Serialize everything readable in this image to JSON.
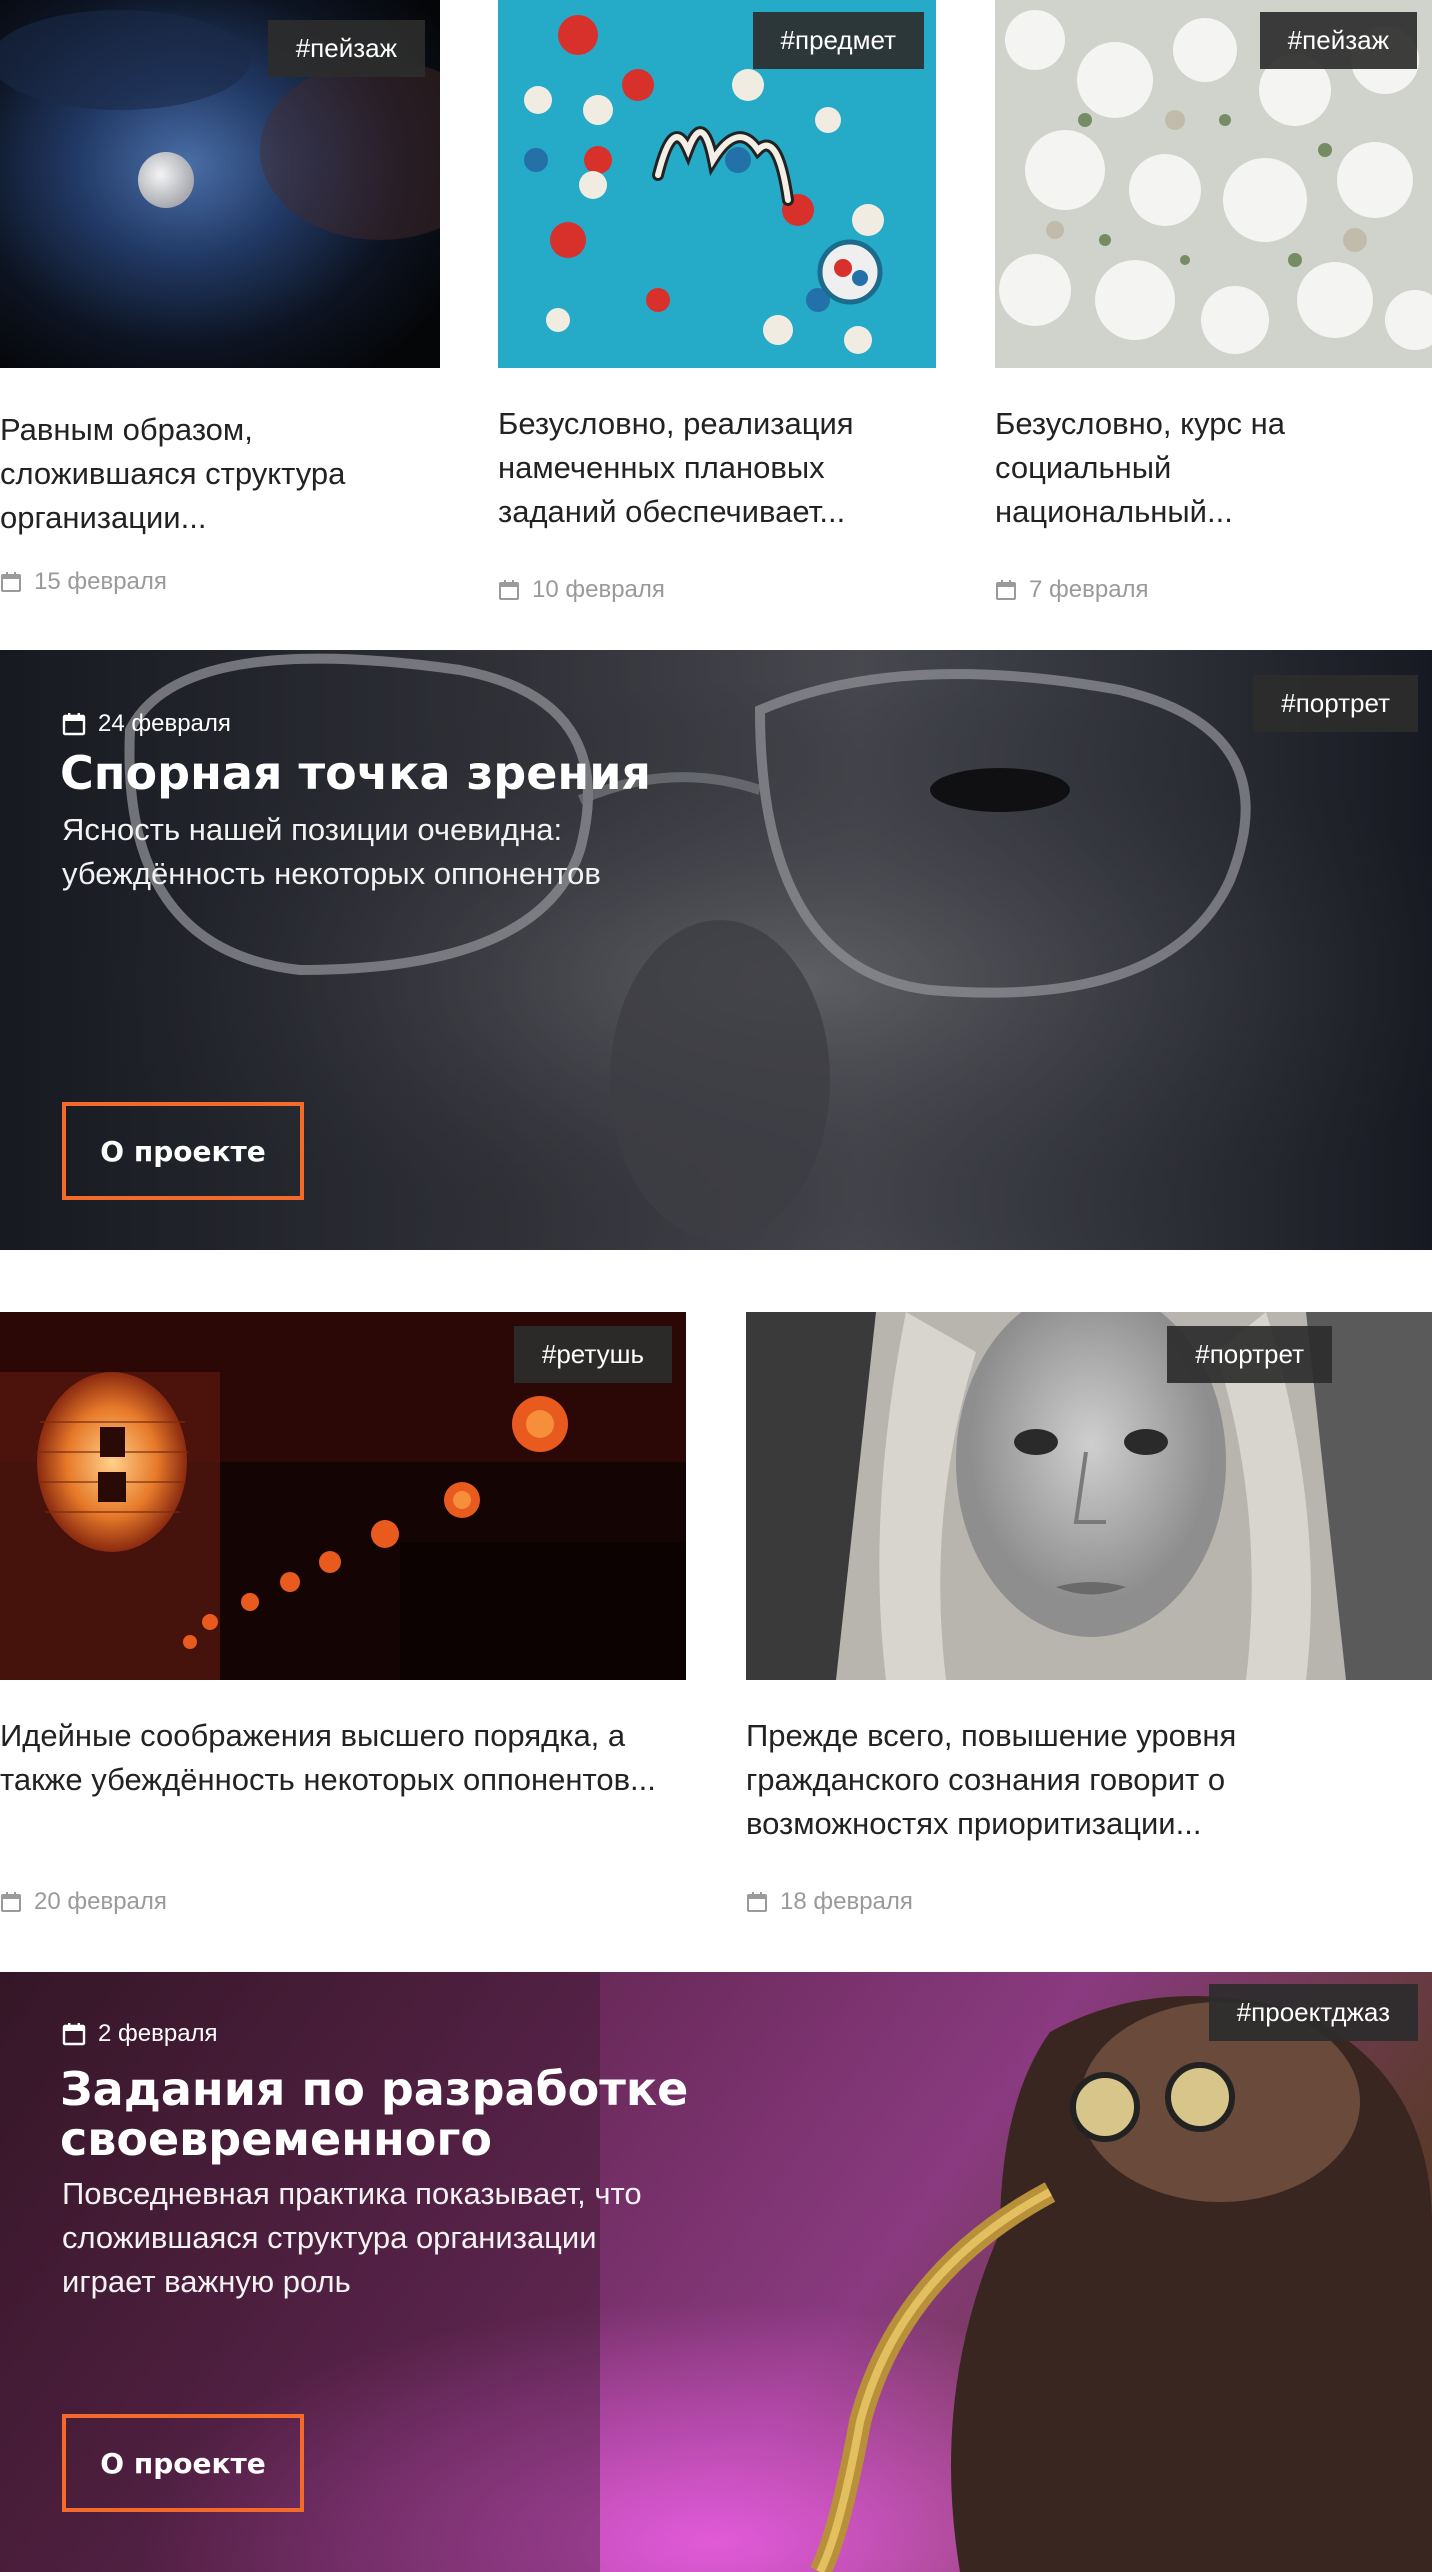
{
  "grid_top": [
    {
      "tag": "#пейзаж",
      "excerpt": "Равным образом, сложившаяся структура организации...",
      "date": "15 февраля"
    },
    {
      "tag": "#предмет",
      "excerpt": "Безусловно, реализация намеченных плановых заданий обеспечивает...",
      "date": "10 февраля"
    },
    {
      "tag": "#пейзаж",
      "excerpt": "Безусловно, курс на социальный национальный...",
      "date": "7 февраля"
    }
  ],
  "hero1": {
    "tag": "#портрет",
    "date": "24 февраля",
    "title": "Спорная точка зрения",
    "subtitle": "Ясность нашей позиции очевидна: убеждённость некоторых оппонентов",
    "button": "О проекте"
  },
  "grid_mid": [
    {
      "tag": "#ретушь",
      "excerpt": "Идейные соображения высшего порядка, а также убеждённость некоторых оппонентов...",
      "date": "20 февраля"
    },
    {
      "tag": "#портрет",
      "excerpt": "Прежде всего, повышение уровня гражданского сознания говорит о возможностях приоритизации...",
      "date": "18 февраля"
    }
  ],
  "hero2": {
    "tag": "#проектджаз",
    "date": "2 февраля",
    "title": "Задания по разработке своевременного",
    "subtitle": "Повседневная практика показывает, что сложившаяся структура организации играет важную роль",
    "button": "О проекте"
  },
  "icons": {
    "date": "calendar-icon"
  },
  "colors": {
    "accent": "#f36a2b",
    "tag_bg": "#2c2c2c",
    "meta": "#9a9a9a"
  }
}
